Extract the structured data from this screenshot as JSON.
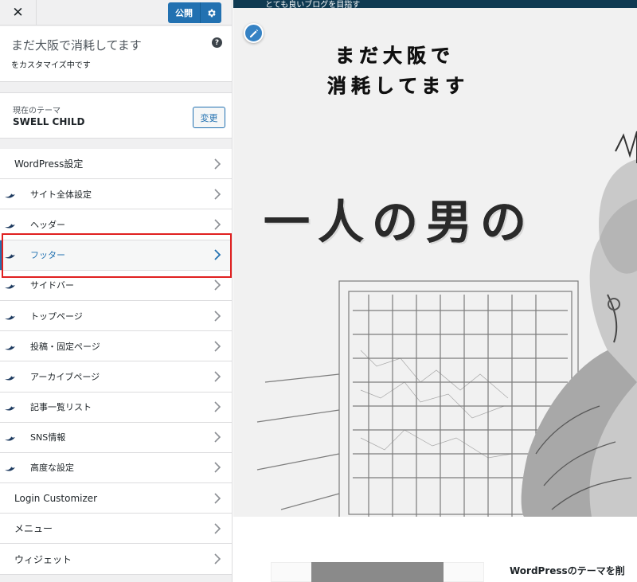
{
  "header": {
    "close_label": "✕",
    "publish_label": "公開",
    "settings_icon": "gear-icon"
  },
  "site": {
    "title": "まだ大阪で消耗してます",
    "subtitle": "をカスタマイズ中です",
    "help": "?"
  },
  "theme": {
    "label": "現在のテーマ",
    "name": "SWELL CHILD",
    "change_label": "変更"
  },
  "menu": {
    "items": [
      {
        "label": "WordPress設定"
      },
      {
        "label": "サイト全体設定"
      },
      {
        "label": "ヘッダー"
      },
      {
        "label": "フッター"
      },
      {
        "label": "サイドバー"
      },
      {
        "label": "トップページ"
      },
      {
        "label": "投稿・固定ページ"
      },
      {
        "label": "アーカイブページ"
      },
      {
        "label": "記事一覧リスト"
      },
      {
        "label": "SNS情報"
      },
      {
        "label": "高度な設定"
      },
      {
        "label": "Login Customizer"
      },
      {
        "label": "メニュー"
      },
      {
        "label": "ウィジェット"
      }
    ]
  },
  "preview": {
    "tagline": "とても良いブログを目指す",
    "hero_title_line1": "まだ大阪で",
    "hero_title_line2": "消耗してます",
    "hero_big_text": "一人の男の",
    "card_title": "WordPressのテーマを削"
  },
  "colors": {
    "accent": "#2271b1",
    "highlight": "#e02020",
    "tagline_bar": "#0f3a52"
  }
}
